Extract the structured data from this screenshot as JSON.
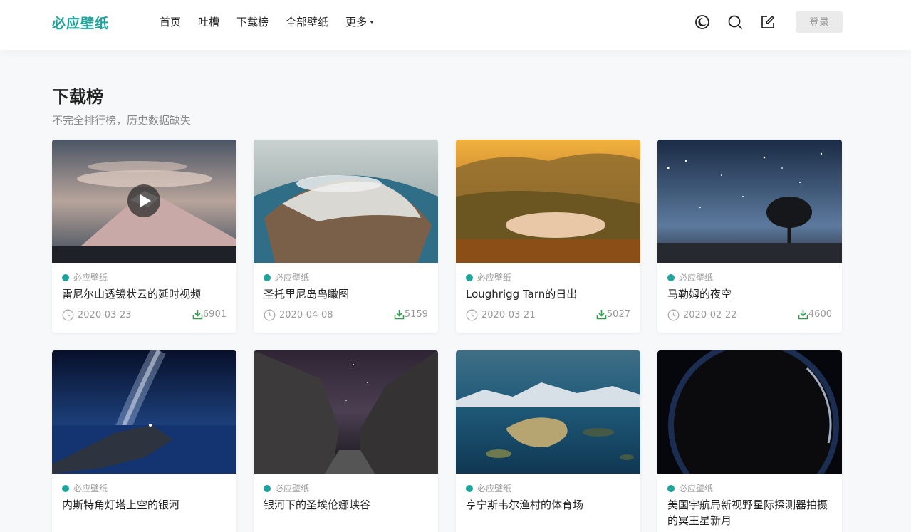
{
  "header": {
    "brand": "必应壁纸",
    "nav": [
      {
        "label": "首页"
      },
      {
        "label": "吐槽"
      },
      {
        "label": "下载榜"
      },
      {
        "label": "全部壁纸"
      },
      {
        "label": "更多"
      }
    ],
    "icons": [
      "moon-icon",
      "search-icon",
      "edit-icon"
    ],
    "login_label": "登录"
  },
  "page": {
    "title": "下载榜",
    "subtitle": "不完全排行榜，历史数据缺失"
  },
  "cards": [
    {
      "source": "必应壁纸",
      "title": "雷尼尔山透镜状云的延时视频",
      "date": "2020-03-23",
      "downloads": "6901",
      "has_video": true
    },
    {
      "source": "必应壁纸",
      "title": "圣托里尼岛鸟瞰图",
      "date": "2020-04-08",
      "downloads": "5159"
    },
    {
      "source": "必应壁纸",
      "title": "Loughrigg Tarn的日出",
      "date": "2020-03-21",
      "downloads": "5027"
    },
    {
      "source": "必应壁纸",
      "title": "马勒姆的夜空",
      "date": "2020-02-22",
      "downloads": "4600"
    },
    {
      "source": "必应壁纸",
      "title": "内斯特角灯塔上空的银河"
    },
    {
      "source": "必应壁纸",
      "title": "银河下的圣埃伦娜峡谷"
    },
    {
      "source": "必应壁纸",
      "title": "亨宁斯韦尔渔村的体育场"
    },
    {
      "source": "必应壁纸",
      "title": "美国宇航局新视野星际探测器拍摄的冥王星新月"
    }
  ],
  "colors": {
    "accent": "#1ea49a",
    "download": "#2e9e4a"
  }
}
